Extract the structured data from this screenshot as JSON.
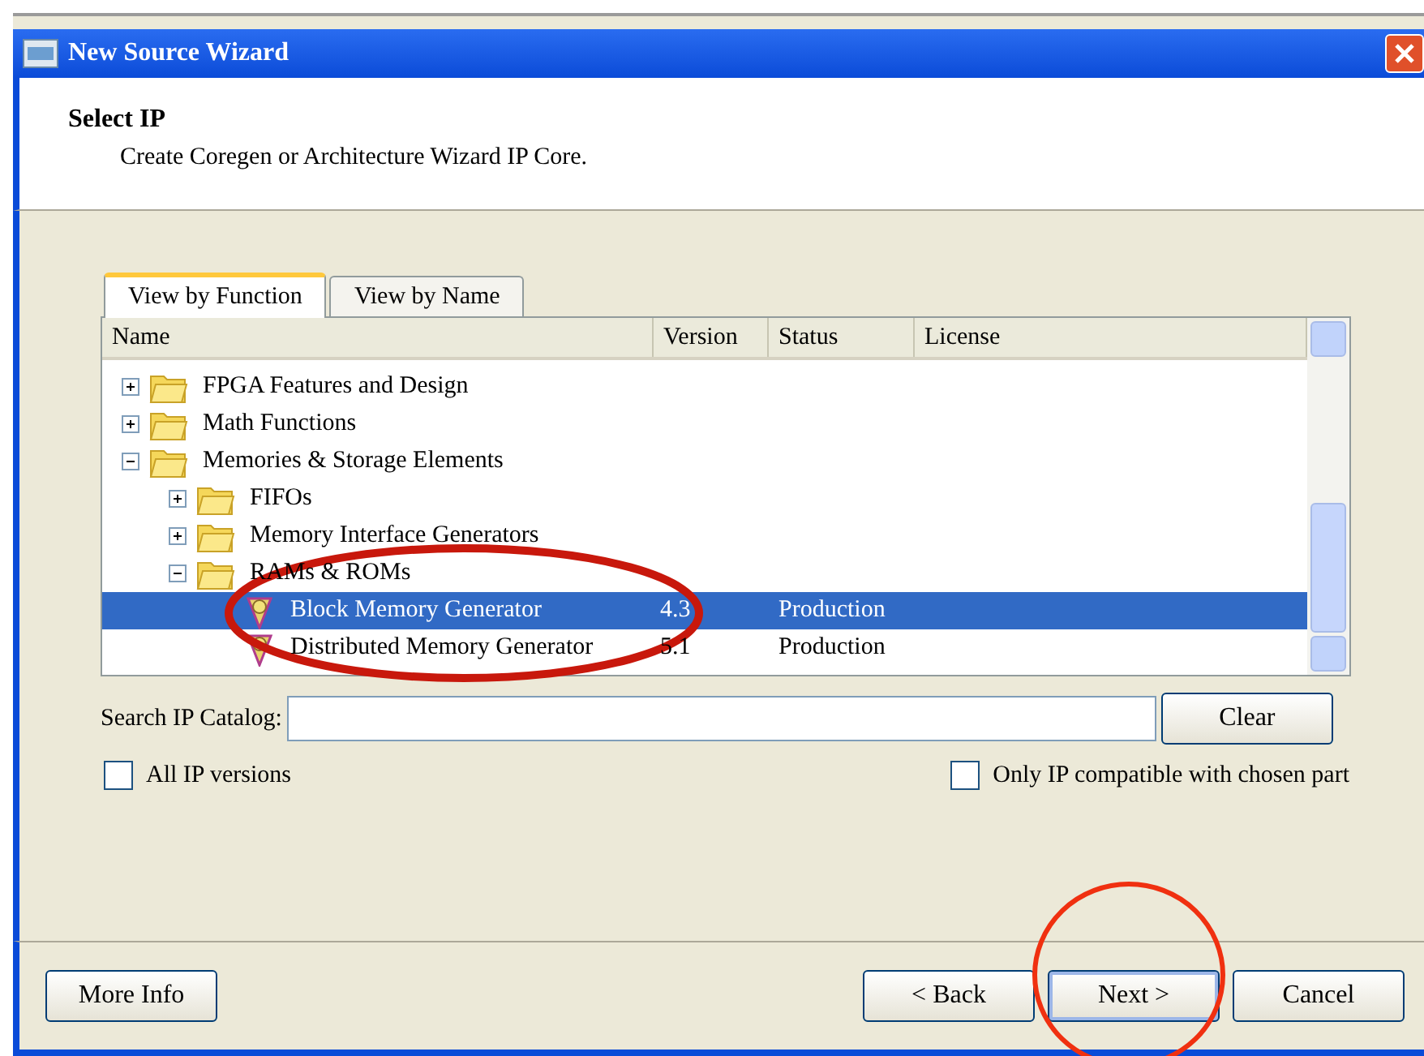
{
  "window": {
    "title": "New Source Wizard"
  },
  "header": {
    "title": "Select IP",
    "subtitle": "Create Coregen or Architecture Wizard IP Core."
  },
  "tabs": [
    {
      "label": "View by Function",
      "selected": true
    },
    {
      "label": "View by Name",
      "selected": false
    }
  ],
  "table": {
    "columns": [
      "Name",
      "Version",
      "Status",
      "License"
    ],
    "rows": [
      {
        "name": "FPGA Features and Design",
        "kind": "folder",
        "expanded": false,
        "selected": false
      },
      {
        "name": "Math Functions",
        "kind": "folder",
        "expanded": false,
        "selected": false
      },
      {
        "name": "Memories & Storage Elements",
        "kind": "folder",
        "expanded": true,
        "selected": false,
        "children": [
          {
            "name": "FIFOs",
            "kind": "folder",
            "expanded": false,
            "selected": false
          },
          {
            "name": "Memory Interface Generators",
            "kind": "folder",
            "expanded": false,
            "selected": false
          },
          {
            "name": "RAMs & ROMs",
            "kind": "folder",
            "expanded": true,
            "selected": false,
            "children": [
              {
                "name": "Block Memory Generator",
                "kind": "core",
                "selected": true,
                "version": "4.3",
                "status": "Production"
              },
              {
                "name": "Distributed Memory Generator",
                "kind": "core",
                "selected": false,
                "version": "5.1",
                "status": "Production"
              }
            ]
          }
        ]
      }
    ]
  },
  "search": {
    "label": "Search IP Catalog:",
    "button": "Clear"
  },
  "options": [
    {
      "label": "All IP versions",
      "checked": false
    },
    {
      "label": "Only IP compatible with chosen part",
      "checked": false
    }
  ],
  "buttons": {
    "left": "More Info",
    "right": [
      "< Back",
      "Next >",
      "Cancel"
    ]
  }
}
